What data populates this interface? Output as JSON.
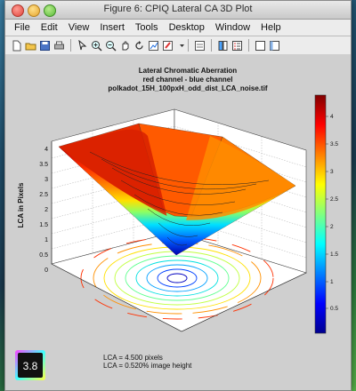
{
  "window": {
    "title": "Figure 6: CPIQ Lateral CA 3D Plot"
  },
  "menu": [
    "File",
    "Edit",
    "View",
    "Insert",
    "Tools",
    "Desktop",
    "Window",
    "Help"
  ],
  "toolbar_icons": [
    "new-figure-icon",
    "open-file-icon",
    "save-icon",
    "print-icon",
    "pointer-icon",
    "zoom-in-icon",
    "zoom-out-icon",
    "pan-icon",
    "rotate-icon",
    "data-cursor-icon",
    "brush-icon",
    "chevron-down-icon",
    "link-icon",
    "colorbar-icon",
    "legend-icon",
    "hide-plot-tools-icon",
    "show-plot-tools-icon"
  ],
  "plot": {
    "title_line1": "Lateral Chromatic Aberration",
    "title_line2": "red channel - blue channel",
    "title_line3": "polkadot_15H_100pxH_odd_dist_LCA_noise.tif",
    "zlabel": "LCA in Pixels",
    "z_ticks": [
      "0",
      "0.5",
      "1",
      "1.5",
      "2",
      "2.5",
      "3",
      "3.5",
      "4"
    ],
    "colorbar_ticks": [
      "0.5",
      "1",
      "1.5",
      "2",
      "2.5",
      "3",
      "3.5",
      "4"
    ],
    "colormap": [
      "#00008f",
      "#0000ff",
      "#0080ff",
      "#00ffff",
      "#80ff80",
      "#ffff00",
      "#ff8000",
      "#ff0000",
      "#800000"
    ]
  },
  "chart_data": {
    "type": "surface3d",
    "title": "Lateral Chromatic Aberration",
    "subtitle": "red channel - blue channel",
    "zlabel": "LCA in Pixels",
    "zlim": [
      0,
      4.3
    ],
    "center_value": 0,
    "corner_max": 4.3,
    "colorbar_range": [
      0.1,
      4.3
    ]
  },
  "stats": {
    "lca_pixels": "LCA = 4.500 pixels",
    "lca_percent": "LCA = 0.520% image height"
  },
  "logo": {
    "text": "3.8"
  }
}
